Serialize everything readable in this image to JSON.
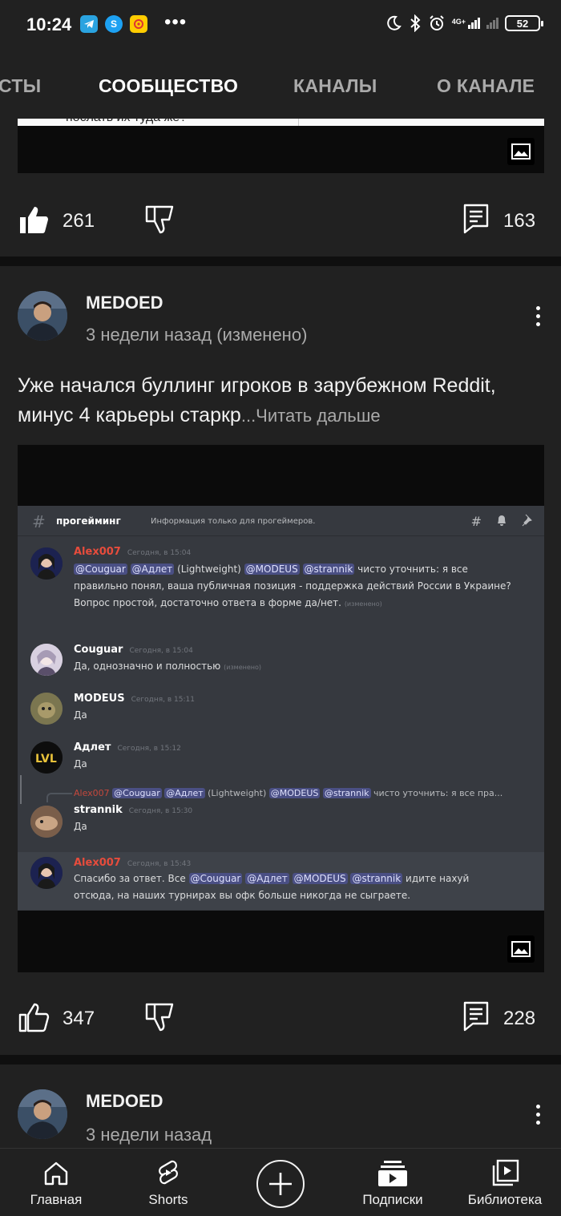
{
  "status_bar": {
    "time": "10:24",
    "dots": "•••",
    "network": "4G+",
    "battery": "52",
    "apps": [
      "telegram-icon",
      "skype-icon",
      "music-app-icon"
    ]
  },
  "tabs": [
    {
      "label": "СТЫ"
    },
    {
      "label": "СООБЩЕСТВО"
    },
    {
      "label": "КАНАЛЫ"
    },
    {
      "label": "О КАНАЛЕ"
    }
  ],
  "active_tab": "СООБЩЕСТВО",
  "top_post": {
    "snippet": "послать их туда же?",
    "likes": "261",
    "comments": "163"
  },
  "post1": {
    "channel": "MEDOED",
    "time": "3 недели назад (изменено)",
    "text": "Уже начался буллинг игроков в зарубежном Reddit, минус 4 карьеры старкр",
    "read_more": "...Читать дальше",
    "likes": "347",
    "comments": "228",
    "discord": {
      "channel": "прогейминг",
      "topic": "Информация только для прогеймеров.",
      "messages": [
        {
          "author": "Alex007",
          "time": "Сегодня, в 15:04",
          "mentions": [
            "@Couguar",
            "@Адлет"
          ],
          "text_a": "(Lightweight)",
          "mentions2": [
            "@MODEUS",
            "@strannik"
          ],
          "text_b": "чисто уточнить: я все правильно понял, ваша публичная позиция - поддержка действий России в Украине?",
          "line2": "Вопрос простой, достаточно ответа в форме да/нет.",
          "edited": "(изменено)"
        },
        {
          "author": "Couguar",
          "time": "Сегодня, в 15:04",
          "text": "Да, однозначно и полностью",
          "edited": "(изменено)"
        },
        {
          "author": "MODEUS",
          "time": "Сегодня, в 15:11",
          "text": "Да"
        },
        {
          "author": "Адлет",
          "time": "Сегодня, в 15:12",
          "text": "Да"
        },
        {
          "reply_author": "Alex007",
          "reply_text": "(Lightweight)",
          "reply_tail": "чисто уточнить: я все пра...",
          "author": "strannik",
          "time": "Сегодня, в 15:30",
          "text": "Да"
        },
        {
          "author": "Alex007",
          "time": "Сегодня, в 15:43",
          "text_a": "Спасибо за ответ. Все",
          "text_b": "идите нахуй",
          "line2": "отсюда, на наших турнирах вы офк больше никогда не сыграете."
        }
      ],
      "m_couguar": "@Couguar",
      "m_adlet": "@Адлет",
      "m_modeus": "@MODEUS",
      "m_strannik": "@strannik"
    }
  },
  "post2": {
    "channel": "MEDOED",
    "time": "3 недели назад"
  },
  "bottom_nav": [
    {
      "label": "Главная",
      "icon": "home-icon"
    },
    {
      "label": "Shorts",
      "icon": "shorts-icon"
    },
    {
      "label": "",
      "icon": "create-icon"
    },
    {
      "label": "Подписки",
      "icon": "subscriptions-icon"
    },
    {
      "label": "Библиотека",
      "icon": "library-icon"
    }
  ],
  "colors": {
    "background": "#212121",
    "divider": "#0f0f0f",
    "discord_bg": "#36393f",
    "mention_bg": "#4a4f84",
    "alex_red": "#e74c3c"
  }
}
